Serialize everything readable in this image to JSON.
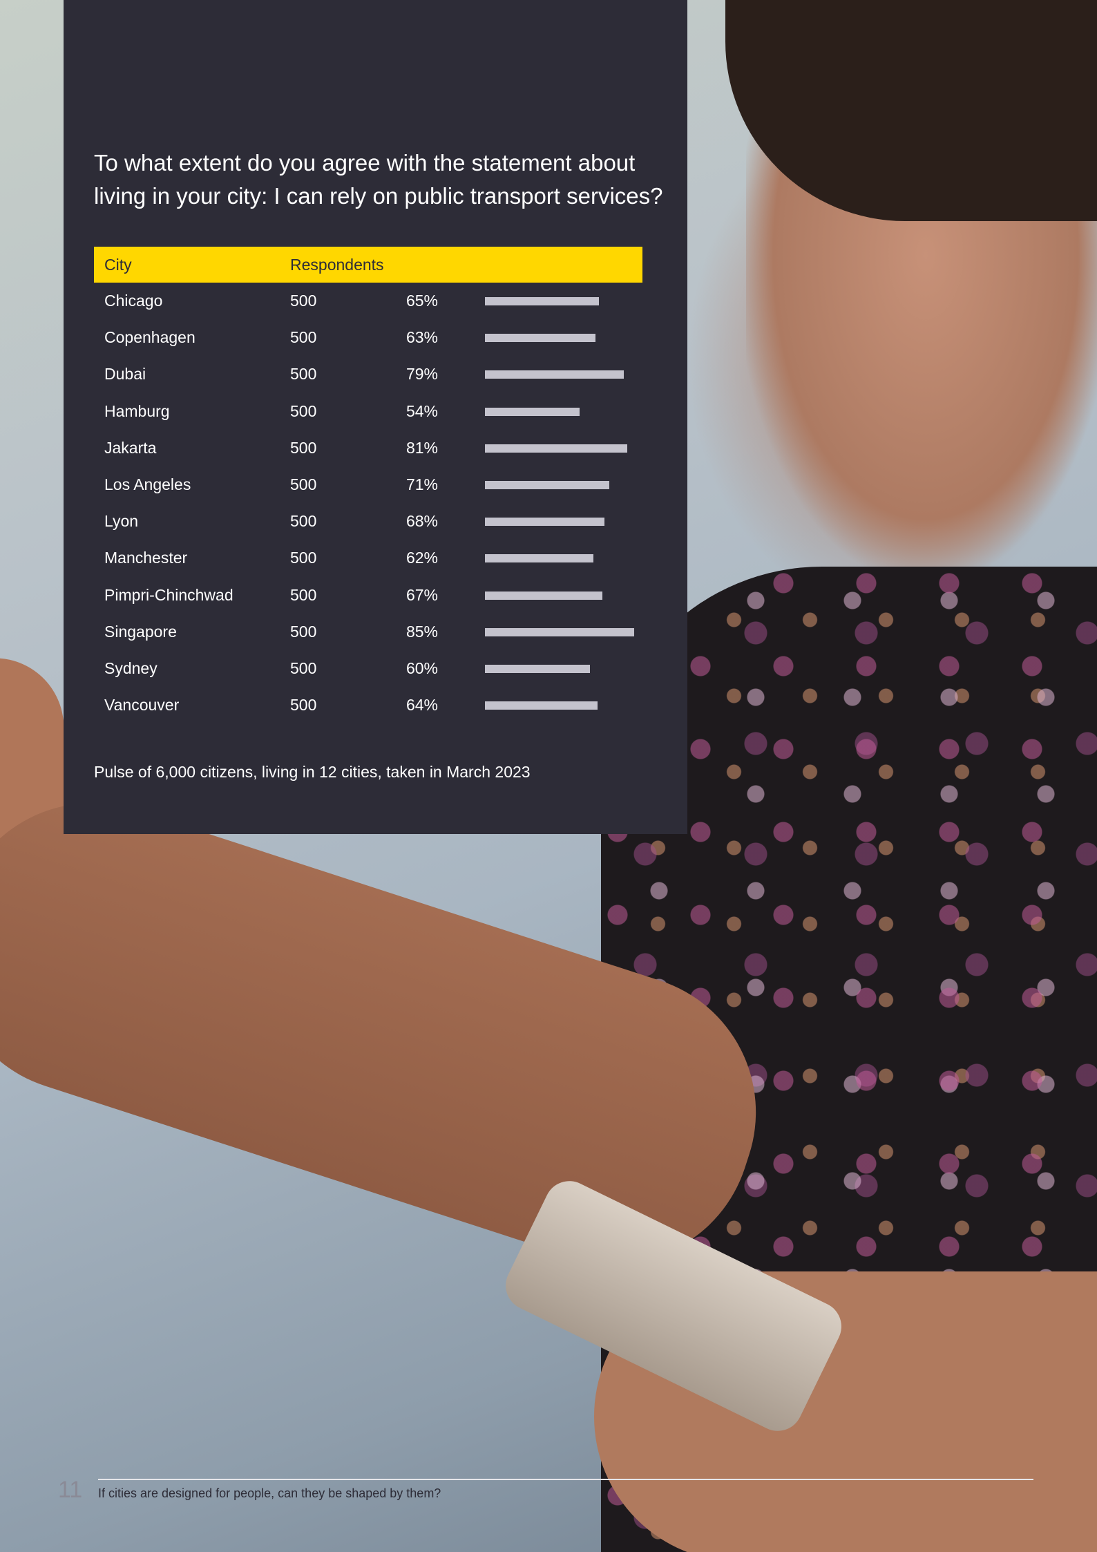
{
  "panel": {
    "question": "To what extent do you agree with the statement about living in your city: I can rely on public transport services?",
    "header": {
      "city": "City",
      "respondents": "Respondents"
    },
    "note": "Pulse of 6,000 citizens, living in 12 cities, taken in March 2023"
  },
  "chart_data": {
    "type": "bar",
    "orientation": "horizontal",
    "columns": [
      "City",
      "Respondents"
    ],
    "categories": [
      "Chicago",
      "Copenhagen",
      "Dubai",
      "Hamburg",
      "Jakarta",
      "Los Angeles",
      "Lyon",
      "Manchester",
      "Pimpri-Chinchwad",
      "Singapore",
      "Sydney",
      "Vancouver"
    ],
    "respondents": [
      "500",
      "500",
      "500",
      "500",
      "500",
      "500",
      "500",
      "500",
      "500",
      "500",
      "500",
      "500"
    ],
    "value_labels": [
      "65%",
      "63%",
      "79%",
      "54%",
      "81%",
      "71%",
      "68%",
      "62%",
      "67%",
      "85%",
      "60%",
      "64%"
    ],
    "values": [
      65,
      63,
      79,
      54,
      81,
      71,
      68,
      62,
      67,
      85,
      60,
      64
    ],
    "bar_color": "#c4c3cd",
    "header_color": "#ffd700"
  },
  "colors": {
    "panel": "#2d2c37",
    "accent": "#ffd700"
  },
  "footer": {
    "page_number": "11",
    "text": "If cities are designed for people, can they be shaped by them?"
  }
}
